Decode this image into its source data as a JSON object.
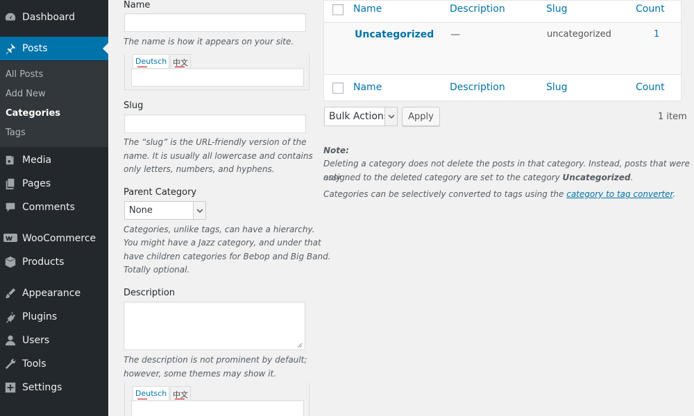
{
  "sidebar": {
    "items": [
      {
        "label": "Dashboard",
        "icon": "dashboard-icon"
      },
      {
        "label": "Posts",
        "icon": "pin-icon",
        "current": true
      },
      {
        "label": "Media",
        "icon": "media-icon"
      },
      {
        "label": "Pages",
        "icon": "pages-icon"
      },
      {
        "label": "Comments",
        "icon": "comments-icon"
      },
      {
        "label": "WooCommerce",
        "icon": "woocommerce-icon"
      },
      {
        "label": "Products",
        "icon": "products-icon"
      },
      {
        "label": "Appearance",
        "icon": "appearance-icon"
      },
      {
        "label": "Plugins",
        "icon": "plugins-icon"
      },
      {
        "label": "Users",
        "icon": "users-icon"
      },
      {
        "label": "Tools",
        "icon": "tools-icon"
      },
      {
        "label": "Settings",
        "icon": "settings-icon"
      }
    ],
    "submenu": [
      "All Posts",
      "Add New",
      "Categories",
      "Tags"
    ],
    "colors": {
      "bg": "#23282d",
      "active": "#0073aa",
      "submenu_bg": "#32373c"
    }
  },
  "form": {
    "name_label": "Name",
    "name_value": "",
    "name_help": "The name is how it appears on your site.",
    "lang_tabs": [
      "Deutsch",
      "中文"
    ],
    "slug_label": "Slug",
    "slug_value": "",
    "slug_help_1": "The “slug” is the URL-friendly version of the",
    "slug_help_2": "name. It is usually all lowercase and contains",
    "slug_help_3": "only letters, numbers, and hyphens.",
    "parent_label": "Parent Category",
    "parent_value": "None",
    "parent_help_1": "Categories, unlike tags, can have a hierarchy.",
    "parent_help_2": "You might have a Jazz category, and under that",
    "parent_help_3": "have children categories for Bebop and Big Band.",
    "parent_help_4": "Totally optional.",
    "desc_label": "Description",
    "desc_value": "",
    "desc_help_1": "The description is not prominent by default;",
    "desc_help_2": "however, some themes may show it."
  },
  "table": {
    "columns": {
      "name": "Name",
      "description": "Description",
      "slug": "Slug",
      "count": "Count"
    },
    "rows": [
      {
        "name": "Uncategorized",
        "description": "—",
        "slug": "uncategorized",
        "count": "1"
      }
    ]
  },
  "actions": {
    "bulk_label": "Bulk Actions",
    "apply_label": "Apply",
    "items_count": "1 item"
  },
  "note": {
    "title": "Note:",
    "line1": "Deleting a category does not delete the posts in that category. Instead, posts that were only",
    "line2_prefix": "assigned to the deleted category are set to the category ",
    "line2_bold": "Uncategorized",
    "line2_suffix": ".",
    "line3_prefix": "Categories can be selectively converted to tags using the ",
    "line3_link": "category to tag converter",
    "line3_suffix": "."
  }
}
